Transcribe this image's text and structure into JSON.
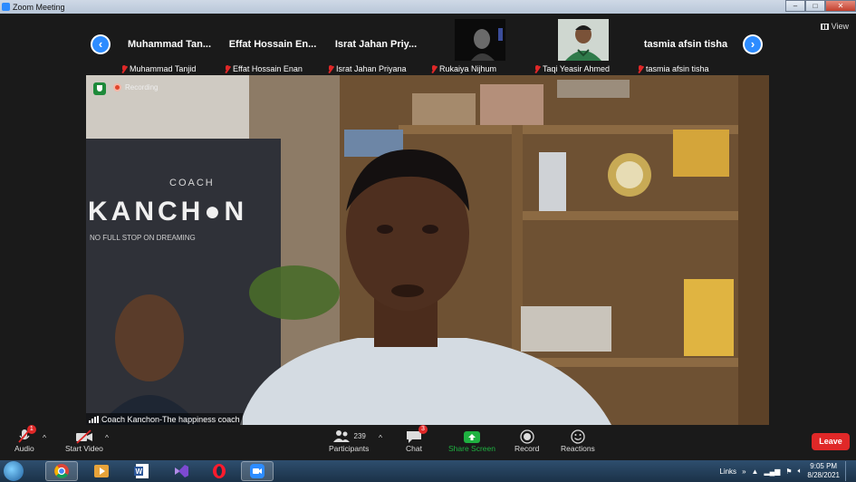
{
  "window": {
    "title": "Zoom Meeting",
    "controls": [
      "–",
      "□",
      "✕"
    ]
  },
  "view_button": {
    "label": "View",
    "icon": "grid-icon"
  },
  "gallery_strip": {
    "tiles": [
      {
        "big_name": "Muhammad  Tan...",
        "label": "Muhammad Tanjid",
        "video": false
      },
      {
        "big_name": "Effat  Hossain En...",
        "label": "Effat Hossain Enan",
        "video": false
      },
      {
        "big_name": "Israt  Jahan  Priy...",
        "label": "Israt Jahan Priyana",
        "video": false
      },
      {
        "big_name": "",
        "label": "Rukaiya Nijhum",
        "video": true
      },
      {
        "big_name": "",
        "label": "Taqi Yeasir Ahmed",
        "video": true
      },
      {
        "big_name": "tasmia afsin tisha",
        "label": "tasmia afsin tisha",
        "video": false
      }
    ],
    "prev_icon": "chevron-left-icon",
    "next_icon": "chevron-right-icon"
  },
  "main_video": {
    "recording_label": "Recording",
    "speaker_label": "Coach Kanchon-The happiness coach",
    "banner": {
      "line1": "COACH",
      "line2": "KANCH●N",
      "line3": "NO FULL STOP ON DREAMING"
    }
  },
  "toolbar": {
    "audio": {
      "label": "Audio",
      "badge": "1"
    },
    "video": {
      "label": "Start Video"
    },
    "participants": {
      "label": "Participants",
      "count": "239"
    },
    "chat": {
      "label": "Chat",
      "badge": "3"
    },
    "share": {
      "label": "Share Screen"
    },
    "record": {
      "label": "Record"
    },
    "reactions": {
      "label": "Reactions"
    },
    "leave": {
      "label": "Leave"
    }
  },
  "taskbar": {
    "links_label": "Links",
    "time": "9:05 PM",
    "date": "8/28/2021"
  },
  "colors": {
    "accent": "#2d8cff",
    "leave": "#e02828",
    "share": "#1fb141",
    "muted": "#e02828"
  }
}
